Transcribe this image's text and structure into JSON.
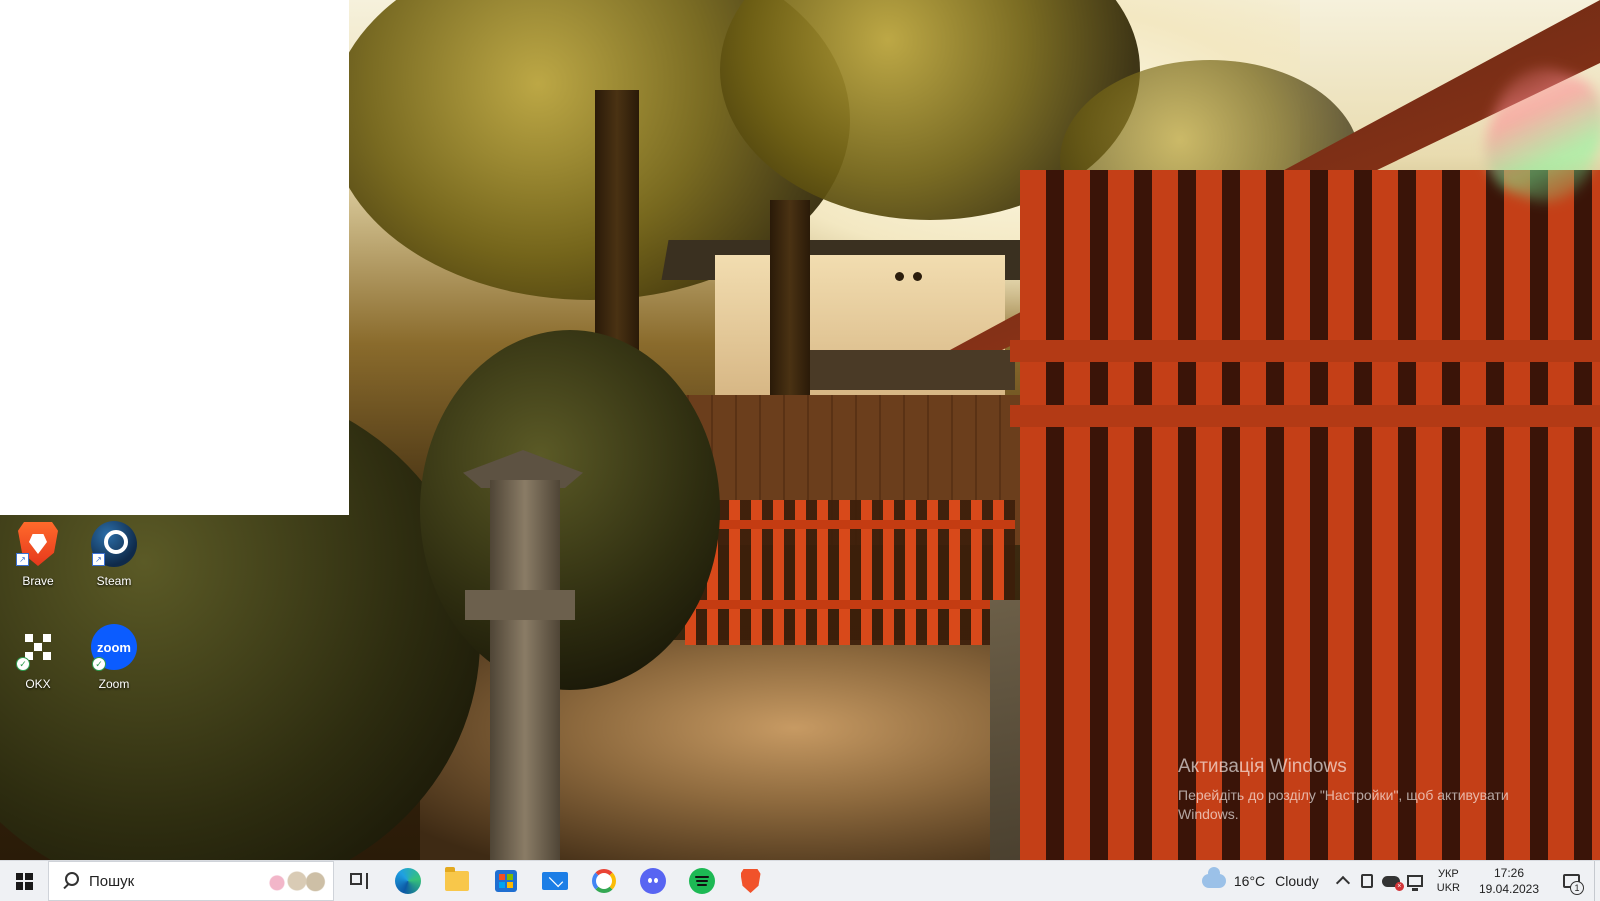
{
  "desktop": {
    "icons": [
      {
        "label": "Brave"
      },
      {
        "label": "Steam"
      },
      {
        "label": "OKX"
      },
      {
        "label": "Zoom"
      }
    ],
    "zoom_logo_text": "zoom",
    "activation": {
      "title": "Активація Windows",
      "message": "Перейдіть до розділу \"Настройки\", щоб активувати Windows."
    }
  },
  "taskbar": {
    "search_placeholder": "Пошук",
    "pinned_apps": [
      {
        "icon": "task-view-icon"
      },
      {
        "icon": "edge-icon"
      },
      {
        "icon": "file-explorer-icon"
      },
      {
        "icon": "microsoft-store-icon"
      },
      {
        "icon": "mail-icon"
      },
      {
        "icon": "google-chrome-icon"
      },
      {
        "icon": "discord-icon"
      },
      {
        "icon": "spotify-icon"
      },
      {
        "icon": "brave-icon"
      }
    ],
    "weather": {
      "temperature": "16°C",
      "condition": "Cloudy"
    },
    "language": {
      "line1": "УКР",
      "line2": "UKR"
    },
    "clock": {
      "time": "17:26",
      "date": "19.04.2023"
    },
    "notification_count": "1"
  },
  "colors": {
    "taskbar_bg": "#eff1f4",
    "zoom_blue": "#0b5cff",
    "brave_orange": "#f1522a",
    "fence_red": "#c43f17"
  }
}
